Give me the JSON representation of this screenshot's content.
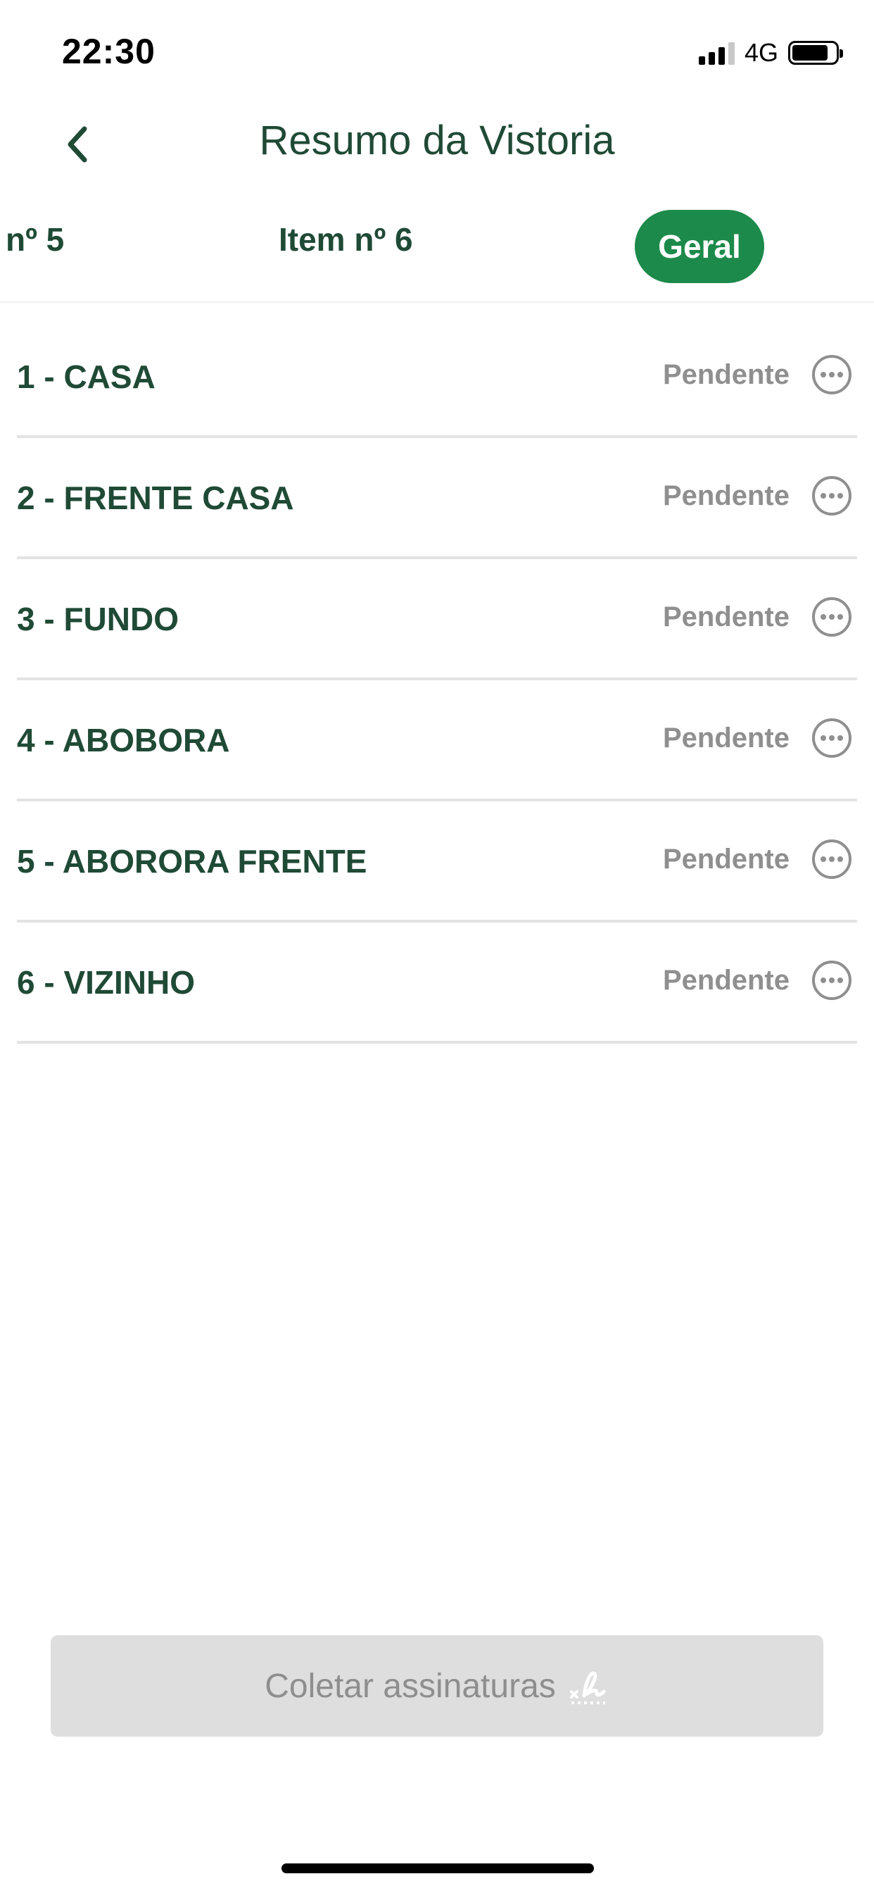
{
  "status_bar": {
    "time": "22:30",
    "network": "4G"
  },
  "header": {
    "title": "Resumo da Vistoria"
  },
  "tabs": [
    {
      "label": "nº 5"
    },
    {
      "label": "Item nº 6"
    },
    {
      "label": "Geral",
      "selected": true
    }
  ],
  "items": [
    {
      "title": "1 - CASA",
      "status": "Pendente"
    },
    {
      "title": "2 - FRENTE CASA",
      "status": "Pendente"
    },
    {
      "title": "3 - FUNDO",
      "status": "Pendente"
    },
    {
      "title": "4 - ABOBORA",
      "status": "Pendente"
    },
    {
      "title": "5 - ABORORA FRENTE",
      "status": "Pendente"
    },
    {
      "title": "6 - VIZINHO",
      "status": "Pendente"
    }
  ],
  "footer": {
    "collect_label": "Coletar assinaturas"
  },
  "colors": {
    "primary_green": "#1c8a4a",
    "text_green": "#1f4a36",
    "status_gray": "#8f8f8f",
    "disabled_button": "#dedede"
  },
  "icons": {
    "back": "chevron-left-icon",
    "more": "more-horizontal-circle-icon",
    "signature": "signature-icon"
  }
}
